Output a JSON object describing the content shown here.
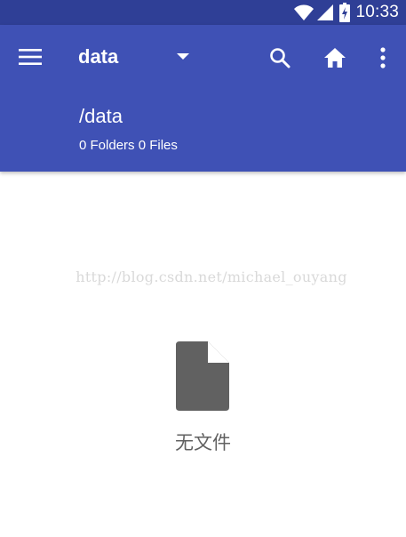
{
  "status_bar": {
    "time": "10:33",
    "icons": [
      "wifi-icon",
      "cellular-signal-icon",
      "battery-charging-icon"
    ]
  },
  "toolbar": {
    "menu_icon": "hamburger-menu-icon",
    "spinner": {
      "selected": "data",
      "icon": "dropdown-arrow-icon"
    },
    "actions": [
      "search-icon",
      "home-icon",
      "more-vert-icon"
    ]
  },
  "path": {
    "title": "/data",
    "summary": "0 Folders 0 Files"
  },
  "watermark": "http://blog.csdn.net/michael_ouyang",
  "empty_state": {
    "icon": "file-icon",
    "message": "无文件"
  },
  "colors": {
    "status_bar": "#2f3f96",
    "toolbar": "#3f51b5",
    "empty_icon": "#616161",
    "watermark": "#d9d9d9"
  }
}
